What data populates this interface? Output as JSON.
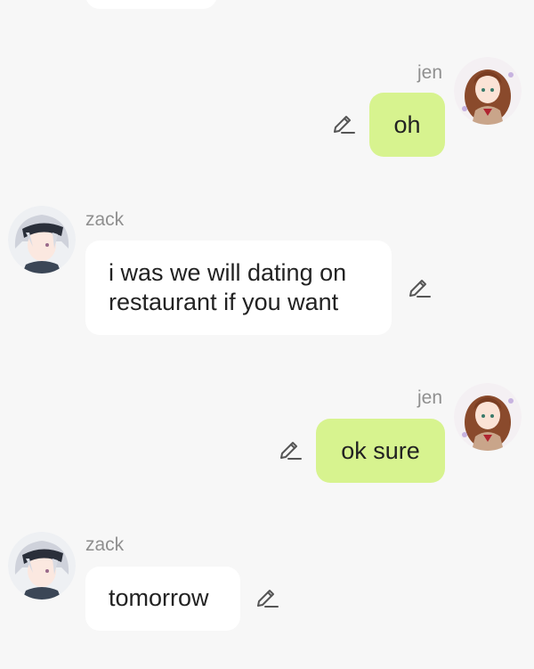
{
  "messages": [
    {
      "sender": "jen",
      "text": "oh"
    },
    {
      "sender": "zack",
      "text_lines": [
        "i was we will dating on",
        "restaurant if you want"
      ]
    },
    {
      "sender": "jen",
      "text": "ok sure"
    },
    {
      "sender": "zack",
      "text": "tomorrow"
    }
  ],
  "colors": {
    "background": "#f7f7f7",
    "own_bubble": "#d7f38f",
    "other_bubble": "#ffffff",
    "sender_name": "#8f8f8f",
    "edit_icon": "#555555"
  },
  "icons": {
    "edit": "pencil-edit-icon"
  }
}
